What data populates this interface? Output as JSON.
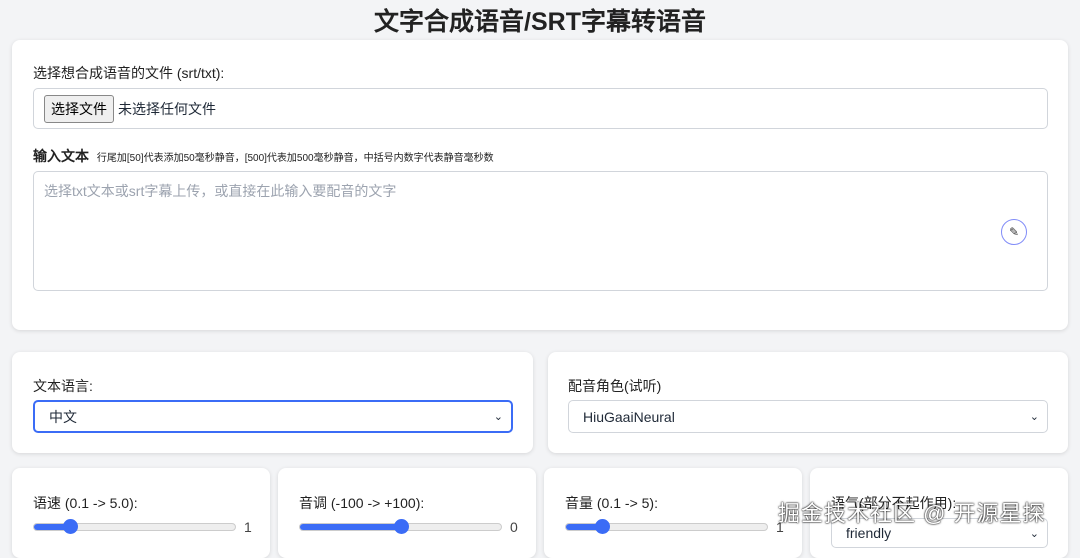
{
  "title": "文字合成语音/SRT字幕转语音",
  "file": {
    "label": "选择想合成语音的文件 (srt/txt):",
    "button": "选择文件",
    "status": "未选择任何文件"
  },
  "text": {
    "label": "输入文本",
    "hint": "行尾加[50]代表添加50毫秒静音，[500]代表加500毫秒静音，中括号内数字代表静音毫秒数",
    "placeholder": "选择txt文本或srt字幕上传，或直接在此输入要配音的文字"
  },
  "language": {
    "label": "文本语言:",
    "value": "中文"
  },
  "voice": {
    "label": "配音角色(试听)",
    "value": "HiuGaaiNeural"
  },
  "speed": {
    "label": "语速 (0.1 -> 5.0):",
    "value": "1",
    "fraction": 0.18
  },
  "pitch": {
    "label": "音调 (-100 -> +100):",
    "value": "0",
    "fraction": 0.5
  },
  "volume": {
    "label": "音量 (0.1 -> 5):",
    "value": "1",
    "fraction": 0.18
  },
  "style": {
    "label": "语气(部分不起作用):",
    "value": "friendly"
  },
  "watermark": "掘金技术社区 @ 开源星探",
  "colors": {
    "accent": "#3b6cf6"
  }
}
